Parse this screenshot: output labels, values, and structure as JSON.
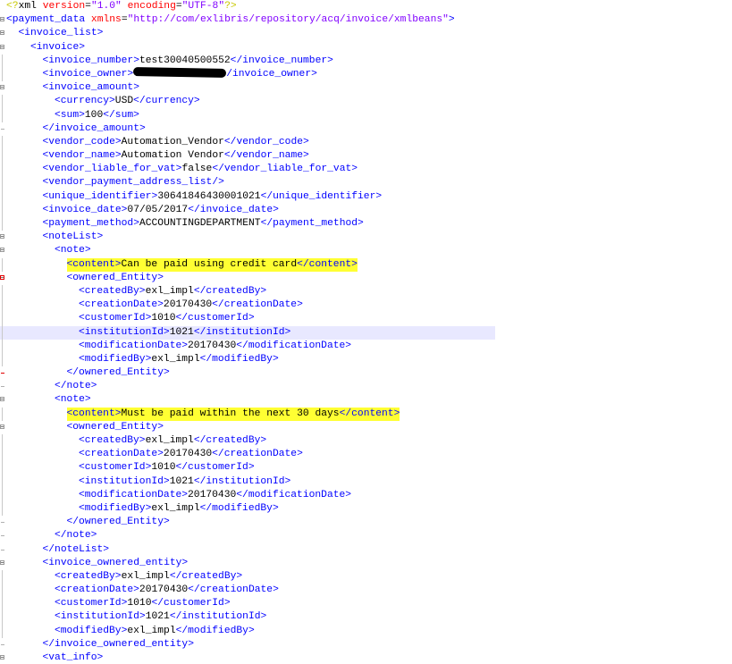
{
  "editor": {
    "lines": [
      {
        "indent": 0,
        "marker": "pi",
        "segments": [
          {
            "k": "pi",
            "s": "<?"
          },
          {
            "k": "x",
            "s": "xml "
          },
          {
            "k": "a",
            "s": "version"
          },
          {
            "k": "x",
            "s": "="
          },
          {
            "k": "v",
            "s": "\"1.0\""
          },
          {
            "k": "x",
            "s": " "
          },
          {
            "k": "a",
            "s": "encoding"
          },
          {
            "k": "x",
            "s": "="
          },
          {
            "k": "v",
            "s": "\"UTF-8\""
          },
          {
            "k": "pi",
            "s": "?>"
          }
        ]
      },
      {
        "indent": 0,
        "marker": "fold",
        "segments": [
          {
            "k": "t",
            "s": "<payment_data "
          },
          {
            "k": "a",
            "s": "xmlns"
          },
          {
            "k": "x",
            "s": "="
          },
          {
            "k": "v",
            "s": "\"http://com/exlibris/repository/acq/invoice/xmlbeans\""
          },
          {
            "k": "t",
            "s": ">"
          }
        ]
      },
      {
        "indent": 1,
        "marker": "fold",
        "segments": [
          {
            "k": "t",
            "s": "<invoice_list>"
          }
        ]
      },
      {
        "indent": 2,
        "marker": "fold",
        "segments": [
          {
            "k": "t",
            "s": "<invoice>"
          }
        ]
      },
      {
        "indent": 3,
        "marker": "guide",
        "segments": [
          {
            "k": "t",
            "s": "<invoice_number>"
          },
          {
            "k": "x",
            "s": "test30040500552"
          },
          {
            "k": "t",
            "s": "</invoice_number>"
          }
        ]
      },
      {
        "indent": 3,
        "marker": "guide",
        "segments": [
          {
            "k": "t",
            "s": "<invoice_owner>"
          },
          {
            "k": "redact",
            "s": ""
          },
          {
            "k": "t",
            "s": "/invoice_owner>"
          }
        ]
      },
      {
        "indent": 3,
        "marker": "fold",
        "segments": [
          {
            "k": "t",
            "s": "<invoice_amount>"
          }
        ]
      },
      {
        "indent": 4,
        "marker": "guide",
        "segments": [
          {
            "k": "t",
            "s": "<currency>"
          },
          {
            "k": "x",
            "s": "USD"
          },
          {
            "k": "t",
            "s": "</currency>"
          }
        ]
      },
      {
        "indent": 4,
        "marker": "guide",
        "segments": [
          {
            "k": "t",
            "s": "<sum>"
          },
          {
            "k": "x",
            "s": "100"
          },
          {
            "k": "t",
            "s": "</sum>"
          }
        ]
      },
      {
        "indent": 3,
        "marker": "end",
        "segments": [
          {
            "k": "t",
            "s": "</invoice_amount>"
          }
        ]
      },
      {
        "indent": 3,
        "marker": "guide",
        "segments": [
          {
            "k": "t",
            "s": "<vendor_code>"
          },
          {
            "k": "x",
            "s": "Automation_Vendor"
          },
          {
            "k": "t",
            "s": "</vendor_code>"
          }
        ]
      },
      {
        "indent": 3,
        "marker": "guide",
        "segments": [
          {
            "k": "t",
            "s": "<vendor_name>"
          },
          {
            "k": "x",
            "s": "Automation Vendor"
          },
          {
            "k": "t",
            "s": "</vendor_name>"
          }
        ]
      },
      {
        "indent": 3,
        "marker": "guide",
        "segments": [
          {
            "k": "t",
            "s": "<vendor_liable_for_vat>"
          },
          {
            "k": "x",
            "s": "false"
          },
          {
            "k": "t",
            "s": "</vendor_liable_for_vat>"
          }
        ]
      },
      {
        "indent": 3,
        "marker": "guide",
        "segments": [
          {
            "k": "t",
            "s": "<vendor_payment_address_list/>"
          }
        ]
      },
      {
        "indent": 3,
        "marker": "guide",
        "segments": [
          {
            "k": "t",
            "s": "<unique_identifier>"
          },
          {
            "k": "x",
            "s": "30641846430001021"
          },
          {
            "k": "t",
            "s": "</unique_identifier>"
          }
        ]
      },
      {
        "indent": 3,
        "marker": "guide",
        "segments": [
          {
            "k": "t",
            "s": "<invoice_date>"
          },
          {
            "k": "x",
            "s": "07/05/2017"
          },
          {
            "k": "t",
            "s": "</invoice_date>"
          }
        ]
      },
      {
        "indent": 3,
        "marker": "guide",
        "segments": [
          {
            "k": "t",
            "s": "<payment_method>"
          },
          {
            "k": "x",
            "s": "ACCOUNTINGDEPARTMENT"
          },
          {
            "k": "t",
            "s": "</payment_method>"
          }
        ]
      },
      {
        "indent": 3,
        "marker": "fold",
        "segments": [
          {
            "k": "t",
            "s": "<noteList>"
          }
        ]
      },
      {
        "indent": 4,
        "marker": "fold",
        "segments": [
          {
            "k": "t",
            "s": "<note>"
          }
        ]
      },
      {
        "indent": 5,
        "marker": "guide",
        "highlight": true,
        "segments": [
          {
            "k": "t",
            "s": "<content>"
          },
          {
            "k": "x",
            "s": "Can be paid using credit card"
          },
          {
            "k": "t",
            "s": "</content>"
          }
        ]
      },
      {
        "indent": 5,
        "marker": "fold-red",
        "segments": [
          {
            "k": "t",
            "s": "<ownered_Entity>"
          }
        ]
      },
      {
        "indent": 6,
        "marker": "guide",
        "segments": [
          {
            "k": "t",
            "s": "<createdBy>"
          },
          {
            "k": "x",
            "s": "exl_impl"
          },
          {
            "k": "t",
            "s": "</createdBy>"
          }
        ]
      },
      {
        "indent": 6,
        "marker": "guide",
        "segments": [
          {
            "k": "t",
            "s": "<creationDate>"
          },
          {
            "k": "x",
            "s": "20170430"
          },
          {
            "k": "t",
            "s": "</creationDate>"
          }
        ]
      },
      {
        "indent": 6,
        "marker": "guide",
        "segments": [
          {
            "k": "t",
            "s": "<customerId>"
          },
          {
            "k": "x",
            "s": "1010"
          },
          {
            "k": "t",
            "s": "</customerId>"
          }
        ]
      },
      {
        "indent": 6,
        "marker": "guide",
        "current": true,
        "segments": [
          {
            "k": "t",
            "s": "<institutionId>"
          },
          {
            "k": "x",
            "s": "1021"
          },
          {
            "k": "t",
            "s": "</institutionId>"
          }
        ]
      },
      {
        "indent": 6,
        "marker": "guide",
        "segments": [
          {
            "k": "t",
            "s": "<modificationDate>"
          },
          {
            "k": "x",
            "s": "20170430"
          },
          {
            "k": "t",
            "s": "</modificationDate>"
          }
        ]
      },
      {
        "indent": 6,
        "marker": "guide",
        "segments": [
          {
            "k": "t",
            "s": "<modifiedBy>"
          },
          {
            "k": "x",
            "s": "exl_impl"
          },
          {
            "k": "t",
            "s": "</modifiedBy>"
          }
        ]
      },
      {
        "indent": 5,
        "marker": "end-red",
        "segments": [
          {
            "k": "t",
            "s": "</ownered_Entity>"
          }
        ]
      },
      {
        "indent": 4,
        "marker": "end",
        "segments": [
          {
            "k": "t",
            "s": "</note>"
          }
        ]
      },
      {
        "indent": 4,
        "marker": "fold",
        "segments": [
          {
            "k": "t",
            "s": "<note>"
          }
        ]
      },
      {
        "indent": 5,
        "marker": "guide",
        "highlight": true,
        "segments": [
          {
            "k": "t",
            "s": "<content>"
          },
          {
            "k": "x",
            "s": "Must be paid within the next 30 days"
          },
          {
            "k": "t",
            "s": "</content>"
          }
        ]
      },
      {
        "indent": 5,
        "marker": "fold",
        "segments": [
          {
            "k": "t",
            "s": "<ownered_Entity>"
          }
        ]
      },
      {
        "indent": 6,
        "marker": "guide",
        "segments": [
          {
            "k": "t",
            "s": "<createdBy>"
          },
          {
            "k": "x",
            "s": "exl_impl"
          },
          {
            "k": "t",
            "s": "</createdBy>"
          }
        ]
      },
      {
        "indent": 6,
        "marker": "guide",
        "segments": [
          {
            "k": "t",
            "s": "<creationDate>"
          },
          {
            "k": "x",
            "s": "20170430"
          },
          {
            "k": "t",
            "s": "</creationDate>"
          }
        ]
      },
      {
        "indent": 6,
        "marker": "guide",
        "segments": [
          {
            "k": "t",
            "s": "<customerId>"
          },
          {
            "k": "x",
            "s": "1010"
          },
          {
            "k": "t",
            "s": "</customerId>"
          }
        ]
      },
      {
        "indent": 6,
        "marker": "guide",
        "segments": [
          {
            "k": "t",
            "s": "<institutionId>"
          },
          {
            "k": "x",
            "s": "1021"
          },
          {
            "k": "t",
            "s": "</institutionId>"
          }
        ]
      },
      {
        "indent": 6,
        "marker": "guide",
        "segments": [
          {
            "k": "t",
            "s": "<modificationDate>"
          },
          {
            "k": "x",
            "s": "20170430"
          },
          {
            "k": "t",
            "s": "</modificationDate>"
          }
        ]
      },
      {
        "indent": 6,
        "marker": "guide",
        "segments": [
          {
            "k": "t",
            "s": "<modifiedBy>"
          },
          {
            "k": "x",
            "s": "exl_impl"
          },
          {
            "k": "t",
            "s": "</modifiedBy>"
          }
        ]
      },
      {
        "indent": 5,
        "marker": "end",
        "segments": [
          {
            "k": "t",
            "s": "</ownered_Entity>"
          }
        ]
      },
      {
        "indent": 4,
        "marker": "end",
        "segments": [
          {
            "k": "t",
            "s": "</note>"
          }
        ]
      },
      {
        "indent": 3,
        "marker": "end",
        "segments": [
          {
            "k": "t",
            "s": "</noteList>"
          }
        ]
      },
      {
        "indent": 3,
        "marker": "fold",
        "segments": [
          {
            "k": "t",
            "s": "<invoice_ownered_entity>"
          }
        ]
      },
      {
        "indent": 4,
        "marker": "guide",
        "segments": [
          {
            "k": "t",
            "s": "<createdBy>"
          },
          {
            "k": "x",
            "s": "exl_impl"
          },
          {
            "k": "t",
            "s": "</createdBy>"
          }
        ]
      },
      {
        "indent": 4,
        "marker": "guide",
        "segments": [
          {
            "k": "t",
            "s": "<creationDate>"
          },
          {
            "k": "x",
            "s": "20170430"
          },
          {
            "k": "t",
            "s": "</creationDate>"
          }
        ]
      },
      {
        "indent": 4,
        "marker": "guide",
        "segments": [
          {
            "k": "t",
            "s": "<customerId>"
          },
          {
            "k": "x",
            "s": "1010"
          },
          {
            "k": "t",
            "s": "</customerId>"
          }
        ]
      },
      {
        "indent": 4,
        "marker": "guide",
        "segments": [
          {
            "k": "t",
            "s": "<institutionId>"
          },
          {
            "k": "x",
            "s": "1021"
          },
          {
            "k": "t",
            "s": "</institutionId>"
          }
        ]
      },
      {
        "indent": 4,
        "marker": "guide",
        "segments": [
          {
            "k": "t",
            "s": "<modifiedBy>"
          },
          {
            "k": "x",
            "s": "exl_impl"
          },
          {
            "k": "t",
            "s": "</modifiedBy>"
          }
        ]
      },
      {
        "indent": 3,
        "marker": "end",
        "segments": [
          {
            "k": "t",
            "s": "</invoice_ownered_entity>"
          }
        ]
      },
      {
        "indent": 3,
        "marker": "fold",
        "segments": [
          {
            "k": "t",
            "s": "<vat_info>"
          }
        ]
      }
    ]
  }
}
